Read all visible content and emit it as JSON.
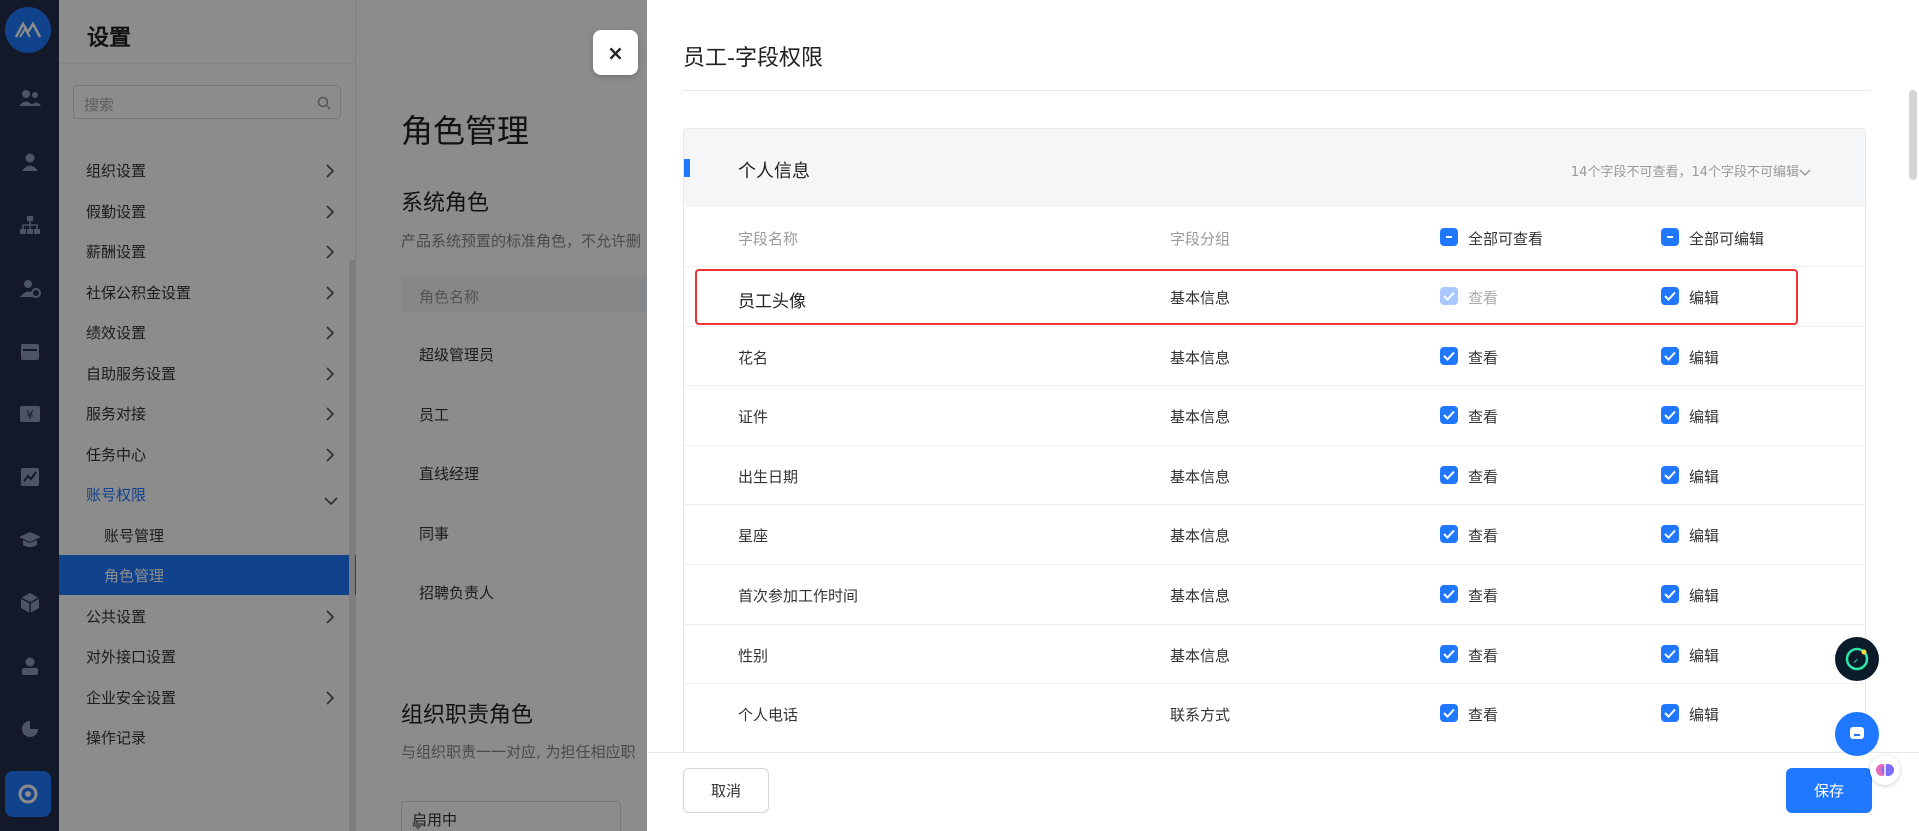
{
  "sidebar": {
    "title": "设置",
    "search_placeholder": "搜索",
    "items": [
      {
        "label": "组织设置"
      },
      {
        "label": "假勤设置"
      },
      {
        "label": "薪酬设置"
      },
      {
        "label": "社保公积金设置"
      },
      {
        "label": "绩效设置"
      },
      {
        "label": "自助服务设置"
      },
      {
        "label": "服务对接"
      },
      {
        "label": "任务中心"
      },
      {
        "label": "账号权限"
      },
      {
        "label": "账号管理"
      },
      {
        "label": "角色管理"
      },
      {
        "label": "公共设置"
      },
      {
        "label": "对外接口设置"
      },
      {
        "label": "企业安全设置"
      },
      {
        "label": "操作记录"
      }
    ]
  },
  "main": {
    "title": "角色管理",
    "system_roles": {
      "title": "系统角色",
      "desc": "产品系统预置的标准角色，不允许删"
    },
    "role_header": "角色名称",
    "roles": [
      "超级管理员",
      "员工",
      "直线经理",
      "同事",
      "招聘负责人"
    ],
    "org_roles": {
      "title": "组织职责角色",
      "desc": "与组织职责一一对应, 为担任相应职"
    },
    "status": "启用中"
  },
  "drawer": {
    "title": "员工-字段权限",
    "group": {
      "name": "个人信息",
      "summary": "14个字段不可查看，14个字段不可编辑"
    },
    "columns": {
      "name": "字段名称",
      "group": "字段分组",
      "view_all": "全部可查看",
      "edit_all": "全部可编辑"
    },
    "rows": [
      {
        "name": "员工头像",
        "group": "基本信息",
        "view": "查看",
        "edit": "编辑"
      },
      {
        "name": "花名",
        "group": "基本信息",
        "view": "查看",
        "edit": "编辑"
      },
      {
        "name": "证件",
        "group": "基本信息",
        "view": "查看",
        "edit": "编辑"
      },
      {
        "name": "出生日期",
        "group": "基本信息",
        "view": "查看",
        "edit": "编辑"
      },
      {
        "name": "星座",
        "group": "基本信息",
        "view": "查看",
        "edit": "编辑"
      },
      {
        "name": "首次参加工作时间",
        "group": "基本信息",
        "view": "查看",
        "edit": "编辑"
      },
      {
        "name": "性别",
        "group": "基本信息",
        "view": "查看",
        "edit": "编辑"
      },
      {
        "name": "个人电话",
        "group": "联系方式",
        "view": "查看",
        "edit": "编辑"
      }
    ],
    "cancel_label": "取消",
    "save_label": "保存",
    "close_label": "×"
  },
  "colors": {
    "accent": "#1f78ff",
    "rail": "#232e4a",
    "highlight": "#ee3333"
  }
}
